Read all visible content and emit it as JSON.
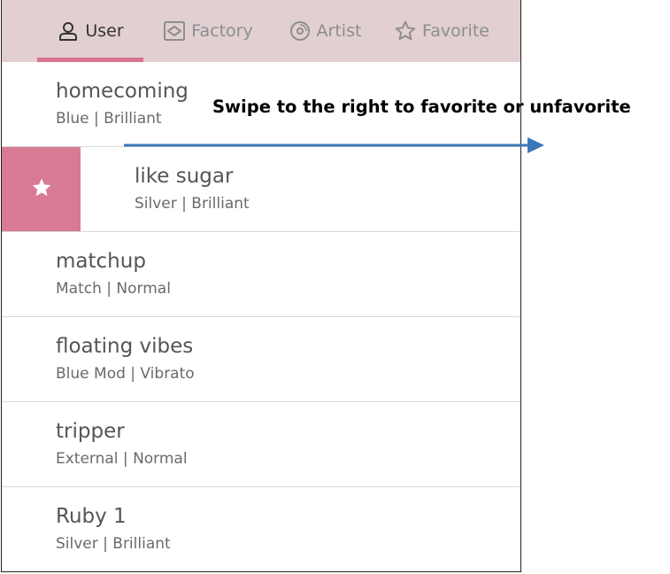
{
  "tabs": [
    {
      "label": "User",
      "icon": "user-icon",
      "active": true
    },
    {
      "label": "Factory",
      "icon": "factory-icon",
      "active": false
    },
    {
      "label": "Artist",
      "icon": "artist-icon",
      "active": false
    },
    {
      "label": "Favorite",
      "icon": "star-outline-icon",
      "active": false
    }
  ],
  "items": [
    {
      "title": "homecoming",
      "subtitle": "Blue | Brilliant"
    },
    {
      "title": "like sugar",
      "subtitle": "Silver | Brilliant"
    },
    {
      "title": "matchup",
      "subtitle": "Match | Normal"
    },
    {
      "title": "floating vibes",
      "subtitle": "Blue Mod | Vibrato"
    },
    {
      "title": "tripper",
      "subtitle": "External | Normal"
    },
    {
      "title": "Ruby 1",
      "subtitle": "Silver | Brilliant"
    }
  ],
  "annotation": {
    "text": "Swipe to the right to favorite or unfavorite"
  },
  "colors": {
    "tabbar_bg": "#e1cfd2",
    "accent": "#d9748f",
    "favorite_action_bg": "#d97a95",
    "arrow": "#3a78b8"
  }
}
